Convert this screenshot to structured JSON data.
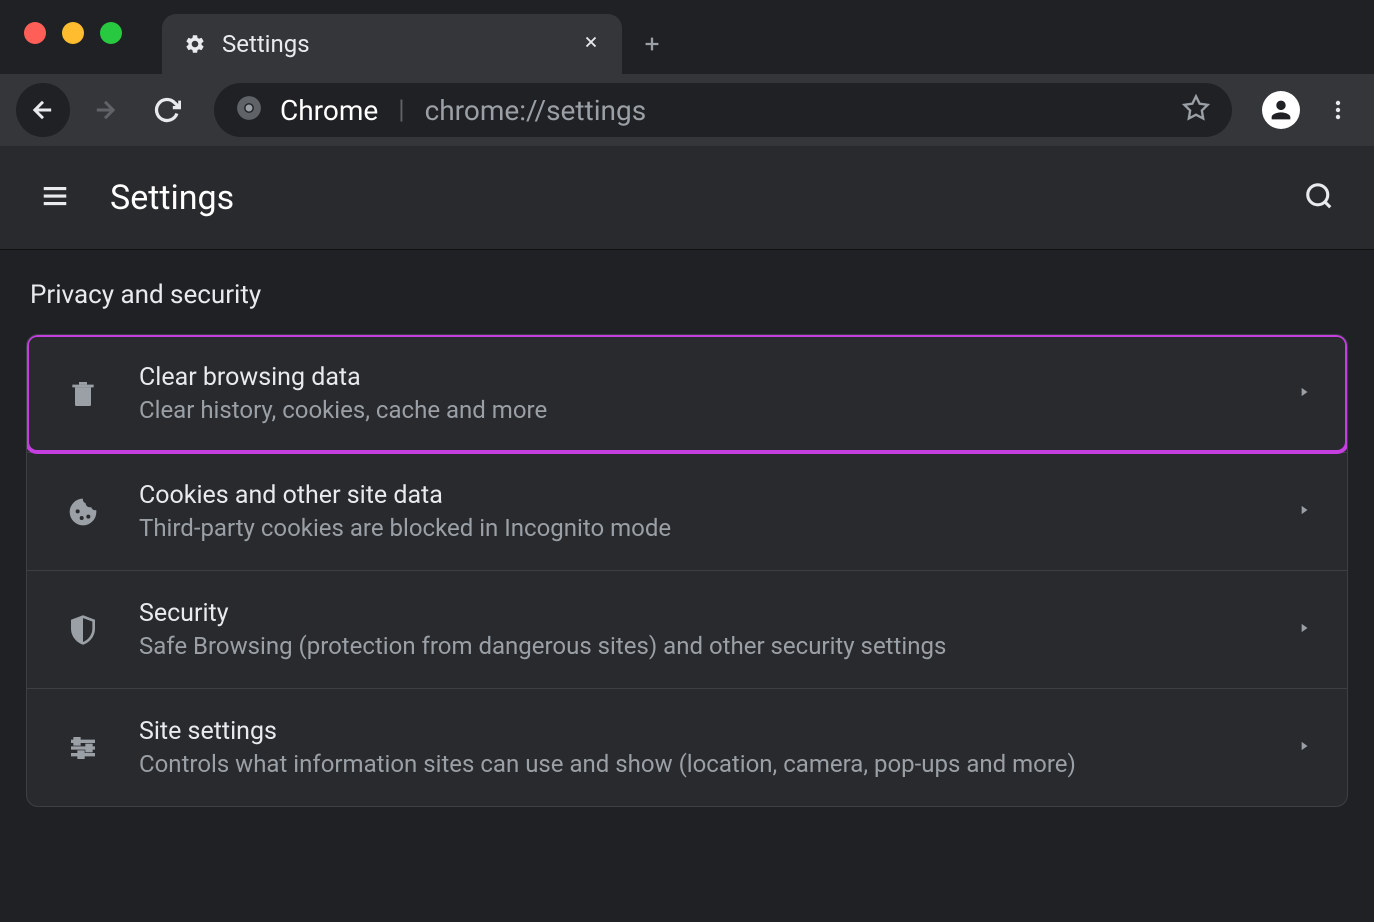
{
  "tab": {
    "title": "Settings"
  },
  "omnibox": {
    "app": "Chrome",
    "url": "chrome://settings"
  },
  "header": {
    "title": "Settings"
  },
  "section": {
    "title": "Privacy and security",
    "rows": [
      {
        "title": "Clear browsing data",
        "desc": "Clear history, cookies, cache and more"
      },
      {
        "title": "Cookies and other site data",
        "desc": "Third-party cookies are blocked in Incognito mode"
      },
      {
        "title": "Security",
        "desc": "Safe Browsing (protection from dangerous sites) and other security settings"
      },
      {
        "title": "Site settings",
        "desc": "Controls what information sites can use and show (location, camera, pop-ups and more)"
      }
    ]
  }
}
